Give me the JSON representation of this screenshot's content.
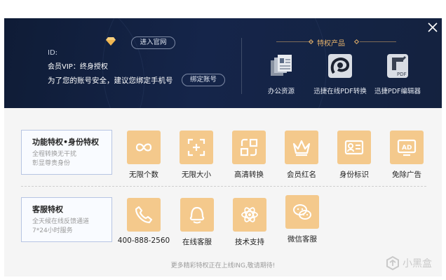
{
  "header": {
    "id_label": "ID:",
    "vip_status": "会员VIP：终身授权",
    "bind_tip": "为了您的账号安全，建议您绑定手机号",
    "visit_site_label": "进入官网",
    "bind_account_label": "绑定账号",
    "products_title": "特权产品",
    "products": [
      {
        "label": "办公资源",
        "icon": "office-resources-icon"
      },
      {
        "label": "迅捷在线PDF转换",
        "icon": "online-pdf-convert-icon"
      },
      {
        "label": "迅捷PDF编辑器",
        "icon": "pdf-editor-icon"
      }
    ]
  },
  "sections": [
    {
      "title": "功能特权•身份特权",
      "subtitle_line1": "全程转换无干扰",
      "subtitle_line2": "彰显尊贵身份",
      "features": [
        {
          "label": "无限个数",
          "icon": "infinity-icon"
        },
        {
          "label": "无限大小",
          "icon": "scan-size-icon"
        },
        {
          "label": "高清转换",
          "icon": "convert-icon"
        },
        {
          "label": "会员红名",
          "icon": "crown-icon"
        },
        {
          "label": "身份标识",
          "icon": "id-card-icon"
        },
        {
          "label": "免除广告",
          "icon": "ad-icon"
        }
      ]
    },
    {
      "title": "客服特权",
      "subtitle_line1": "全天候在线反馈通道",
      "subtitle_line2": "7*24小时服务",
      "features": [
        {
          "label": "400-888-2560",
          "icon": "phone-icon"
        },
        {
          "label": "在线客服",
          "icon": "online-chat-icon"
        },
        {
          "label": "技术支持",
          "icon": "atom-icon"
        },
        {
          "label": "微信客服",
          "icon": "wechat-icon"
        }
      ]
    }
  ],
  "footer_note": "更多精彩特权正在上线ING,敬请期待!",
  "watermark": "小黑盒",
  "colors": {
    "header_bg": "#14223f",
    "accent_gold": "#e5b26b",
    "tile": "#f4c98c",
    "tile_icon": "#ffffff"
  }
}
